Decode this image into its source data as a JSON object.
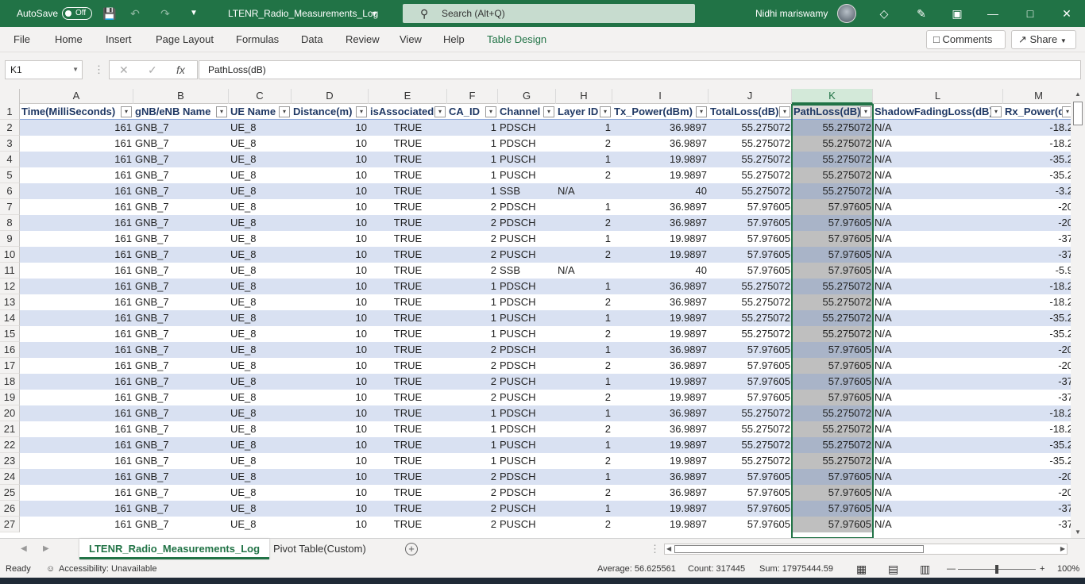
{
  "titlebar": {
    "autosave_label": "AutoSave",
    "autosave_state": "Off",
    "filename": "LTENR_Radio_Measurements_Log",
    "search_placeholder": "Search (Alt+Q)",
    "user_name": "Nidhi mariswamy",
    "bg_color": "#217346"
  },
  "ribbon": {
    "tabs": [
      "File",
      "Home",
      "Insert",
      "Page Layout",
      "Formulas",
      "Data",
      "Review",
      "View",
      "Help",
      "Table Design"
    ],
    "active_tab": "Table Design",
    "comments_label": "Comments",
    "share_label": "Share"
  },
  "formula_bar": {
    "name_box": "K1",
    "formula": "PathLoss(dB)"
  },
  "columns": [
    "A",
    "B",
    "C",
    "D",
    "E",
    "F",
    "G",
    "H",
    "I",
    "J",
    "K",
    "L",
    "M"
  ],
  "selected_column": "K",
  "headers": [
    "Time(MilliSeconds)",
    "gNB/eNB Name",
    "UE Name",
    "Distance(m)",
    "isAssociated",
    "CA_ID",
    "Channel",
    "Layer ID",
    "Tx_Power(dBm)",
    "TotalLoss(dB)",
    "PathLoss(dB)",
    "ShadowFadingLoss(dB)",
    "Rx_Power(dBm)"
  ],
  "rows": [
    {
      "n": "2",
      "c": [
        "161",
        "GNB_7",
        "UE_8",
        "10",
        "TRUE",
        "1",
        "PDSCH",
        "1",
        "36.9897",
        "55.275072",
        "55.275072",
        "N/A",
        "-18.2"
      ]
    },
    {
      "n": "3",
      "c": [
        "161",
        "GNB_7",
        "UE_8",
        "10",
        "TRUE",
        "1",
        "PDSCH",
        "2",
        "36.9897",
        "55.275072",
        "55.275072",
        "N/A",
        "-18.2"
      ]
    },
    {
      "n": "4",
      "c": [
        "161",
        "GNB_7",
        "UE_8",
        "10",
        "TRUE",
        "1",
        "PUSCH",
        "1",
        "19.9897",
        "55.275072",
        "55.275072",
        "N/A",
        "-35.2"
      ]
    },
    {
      "n": "5",
      "c": [
        "161",
        "GNB_7",
        "UE_8",
        "10",
        "TRUE",
        "1",
        "PUSCH",
        "2",
        "19.9897",
        "55.275072",
        "55.275072",
        "N/A",
        "-35.2"
      ]
    },
    {
      "n": "6",
      "c": [
        "161",
        "GNB_7",
        "UE_8",
        "10",
        "TRUE",
        "1",
        "SSB",
        "N/A",
        "40",
        "55.275072",
        "55.275072",
        "N/A",
        "-3.2"
      ]
    },
    {
      "n": "7",
      "c": [
        "161",
        "GNB_7",
        "UE_8",
        "10",
        "TRUE",
        "2",
        "PDSCH",
        "1",
        "36.9897",
        "57.97605",
        "57.97605",
        "N/A",
        "-20"
      ]
    },
    {
      "n": "8",
      "c": [
        "161",
        "GNB_7",
        "UE_8",
        "10",
        "TRUE",
        "2",
        "PDSCH",
        "2",
        "36.9897",
        "57.97605",
        "57.97605",
        "N/A",
        "-20"
      ]
    },
    {
      "n": "9",
      "c": [
        "161",
        "GNB_7",
        "UE_8",
        "10",
        "TRUE",
        "2",
        "PUSCH",
        "1",
        "19.9897",
        "57.97605",
        "57.97605",
        "N/A",
        "-37"
      ]
    },
    {
      "n": "10",
      "c": [
        "161",
        "GNB_7",
        "UE_8",
        "10",
        "TRUE",
        "2",
        "PUSCH",
        "2",
        "19.9897",
        "57.97605",
        "57.97605",
        "N/A",
        "-37"
      ]
    },
    {
      "n": "11",
      "c": [
        "161",
        "GNB_7",
        "UE_8",
        "10",
        "TRUE",
        "2",
        "SSB",
        "N/A",
        "40",
        "57.97605",
        "57.97605",
        "N/A",
        "-5.9"
      ]
    },
    {
      "n": "12",
      "c": [
        "161",
        "GNB_7",
        "UE_8",
        "10",
        "TRUE",
        "1",
        "PDSCH",
        "1",
        "36.9897",
        "55.275072",
        "55.275072",
        "N/A",
        "-18.2"
      ]
    },
    {
      "n": "13",
      "c": [
        "161",
        "GNB_7",
        "UE_8",
        "10",
        "TRUE",
        "1",
        "PDSCH",
        "2",
        "36.9897",
        "55.275072",
        "55.275072",
        "N/A",
        "-18.2"
      ]
    },
    {
      "n": "14",
      "c": [
        "161",
        "GNB_7",
        "UE_8",
        "10",
        "TRUE",
        "1",
        "PUSCH",
        "1",
        "19.9897",
        "55.275072",
        "55.275072",
        "N/A",
        "-35.2"
      ]
    },
    {
      "n": "15",
      "c": [
        "161",
        "GNB_7",
        "UE_8",
        "10",
        "TRUE",
        "1",
        "PUSCH",
        "2",
        "19.9897",
        "55.275072",
        "55.275072",
        "N/A",
        "-35.2"
      ]
    },
    {
      "n": "16",
      "c": [
        "161",
        "GNB_7",
        "UE_8",
        "10",
        "TRUE",
        "2",
        "PDSCH",
        "1",
        "36.9897",
        "57.97605",
        "57.97605",
        "N/A",
        "-20"
      ]
    },
    {
      "n": "17",
      "c": [
        "161",
        "GNB_7",
        "UE_8",
        "10",
        "TRUE",
        "2",
        "PDSCH",
        "2",
        "36.9897",
        "57.97605",
        "57.97605",
        "N/A",
        "-20"
      ]
    },
    {
      "n": "18",
      "c": [
        "161",
        "GNB_7",
        "UE_8",
        "10",
        "TRUE",
        "2",
        "PUSCH",
        "1",
        "19.9897",
        "57.97605",
        "57.97605",
        "N/A",
        "-37"
      ]
    },
    {
      "n": "19",
      "c": [
        "161",
        "GNB_7",
        "UE_8",
        "10",
        "TRUE",
        "2",
        "PUSCH",
        "2",
        "19.9897",
        "57.97605",
        "57.97605",
        "N/A",
        "-37"
      ]
    },
    {
      "n": "20",
      "c": [
        "161",
        "GNB_7",
        "UE_8",
        "10",
        "TRUE",
        "1",
        "PDSCH",
        "1",
        "36.9897",
        "55.275072",
        "55.275072",
        "N/A",
        "-18.2"
      ]
    },
    {
      "n": "21",
      "c": [
        "161",
        "GNB_7",
        "UE_8",
        "10",
        "TRUE",
        "1",
        "PDSCH",
        "2",
        "36.9897",
        "55.275072",
        "55.275072",
        "N/A",
        "-18.2"
      ]
    },
    {
      "n": "22",
      "c": [
        "161",
        "GNB_7",
        "UE_8",
        "10",
        "TRUE",
        "1",
        "PUSCH",
        "1",
        "19.9897",
        "55.275072",
        "55.275072",
        "N/A",
        "-35.2"
      ]
    },
    {
      "n": "23",
      "c": [
        "161",
        "GNB_7",
        "UE_8",
        "10",
        "TRUE",
        "1",
        "PUSCH",
        "2",
        "19.9897",
        "55.275072",
        "55.275072",
        "N/A",
        "-35.2"
      ]
    },
    {
      "n": "24",
      "c": [
        "161",
        "GNB_7",
        "UE_8",
        "10",
        "TRUE",
        "2",
        "PDSCH",
        "1",
        "36.9897",
        "57.97605",
        "57.97605",
        "N/A",
        "-20"
      ]
    },
    {
      "n": "25",
      "c": [
        "161",
        "GNB_7",
        "UE_8",
        "10",
        "TRUE",
        "2",
        "PDSCH",
        "2",
        "36.9897",
        "57.97605",
        "57.97605",
        "N/A",
        "-20"
      ]
    },
    {
      "n": "26",
      "c": [
        "161",
        "GNB_7",
        "UE_8",
        "10",
        "TRUE",
        "2",
        "PUSCH",
        "1",
        "19.9897",
        "57.97605",
        "57.97605",
        "N/A",
        "-37"
      ]
    },
    {
      "n": "27",
      "c": [
        "161",
        "GNB_7",
        "UE_8",
        "10",
        "TRUE",
        "2",
        "PUSCH",
        "2",
        "19.9897",
        "57.97605",
        "57.97605",
        "N/A",
        "-37"
      ]
    }
  ],
  "sheets": {
    "active": "LTENR_Radio_Measurements_Log",
    "other": "Pivot Table(Custom)"
  },
  "status": {
    "ready": "Ready",
    "accessibility": "Accessibility: Unavailable",
    "average": "Average: 56.625561",
    "count": "Count: 317445",
    "sum": "Sum: 17975444.59",
    "zoom": "100%"
  },
  "colors": {
    "accent": "#217346",
    "band": "#d9e1f2",
    "header_text": "#1f3864"
  },
  "icons": [
    "save-icon",
    "undo-icon",
    "redo-icon",
    "customize-icon",
    "search-icon",
    "diamond-icon",
    "pen-icon",
    "restore-icon",
    "minimize-icon",
    "maximize-icon",
    "close-icon",
    "filter-dropdown-icon"
  ]
}
